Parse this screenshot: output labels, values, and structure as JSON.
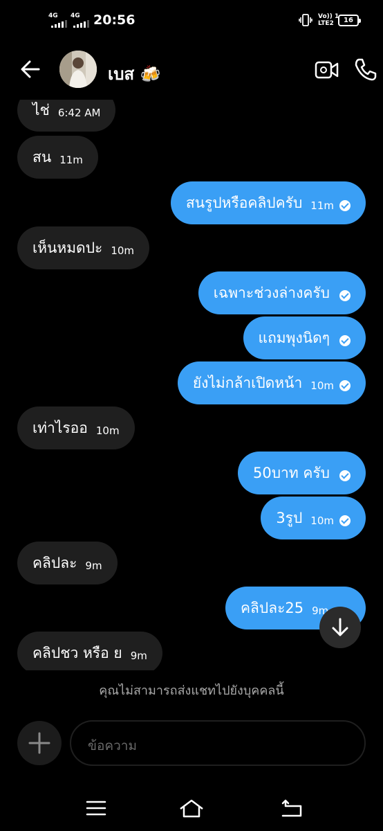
{
  "status_bar": {
    "sim1_network": "4G",
    "sim2_network": "4G",
    "time": "20:56",
    "volte_top": "Vo)) 1",
    "volte_bottom": "LTE2",
    "battery": "16"
  },
  "header": {
    "contact_name": "เบส 🍻"
  },
  "messages": [
    {
      "dir": "in",
      "text": "ไช่",
      "time": "6:42 AM"
    },
    {
      "dir": "in",
      "text": "สน",
      "time": "11m"
    },
    {
      "dir": "out",
      "text": "สนรูปหรือคลิปครับ",
      "time": "11m"
    },
    {
      "dir": "in",
      "text": "เห็นหมดปะ",
      "time": "10m"
    },
    {
      "dir": "out",
      "text": "เฉพาะช่วงล่างครับ",
      "time": ""
    },
    {
      "dir": "out",
      "text": "แถมพุงนิดๆ",
      "time": ""
    },
    {
      "dir": "out",
      "text": "ยังไม่กล้าเปิดหน้า",
      "time": "10m"
    },
    {
      "dir": "in",
      "text": "เท่าไรออ",
      "time": "10m"
    },
    {
      "dir": "out",
      "text": "50บาท ครับ",
      "time": ""
    },
    {
      "dir": "out",
      "text": "3รูป",
      "time": "10m"
    },
    {
      "dir": "in",
      "text": "คลิปละ",
      "time": "9m"
    },
    {
      "dir": "out",
      "text": "คลิปละ25",
      "time": "9m"
    },
    {
      "dir": "in",
      "text": "คลิปชว หรือ ย",
      "time": "9m"
    }
  ],
  "notice": "คุณไม่สามารถส่งแชทไปยังบุคคลนี้",
  "composer": {
    "placeholder": "ข้อความ"
  },
  "colors": {
    "outgoing_bubble": "#3a9ff5",
    "incoming_bubble": "#1f1f1f",
    "background": "#000000"
  },
  "icons": [
    "back-arrow-icon",
    "video-call-icon",
    "phone-icon",
    "plus-icon",
    "arrow-down-icon",
    "menu-icon",
    "home-icon",
    "return-icon"
  ]
}
